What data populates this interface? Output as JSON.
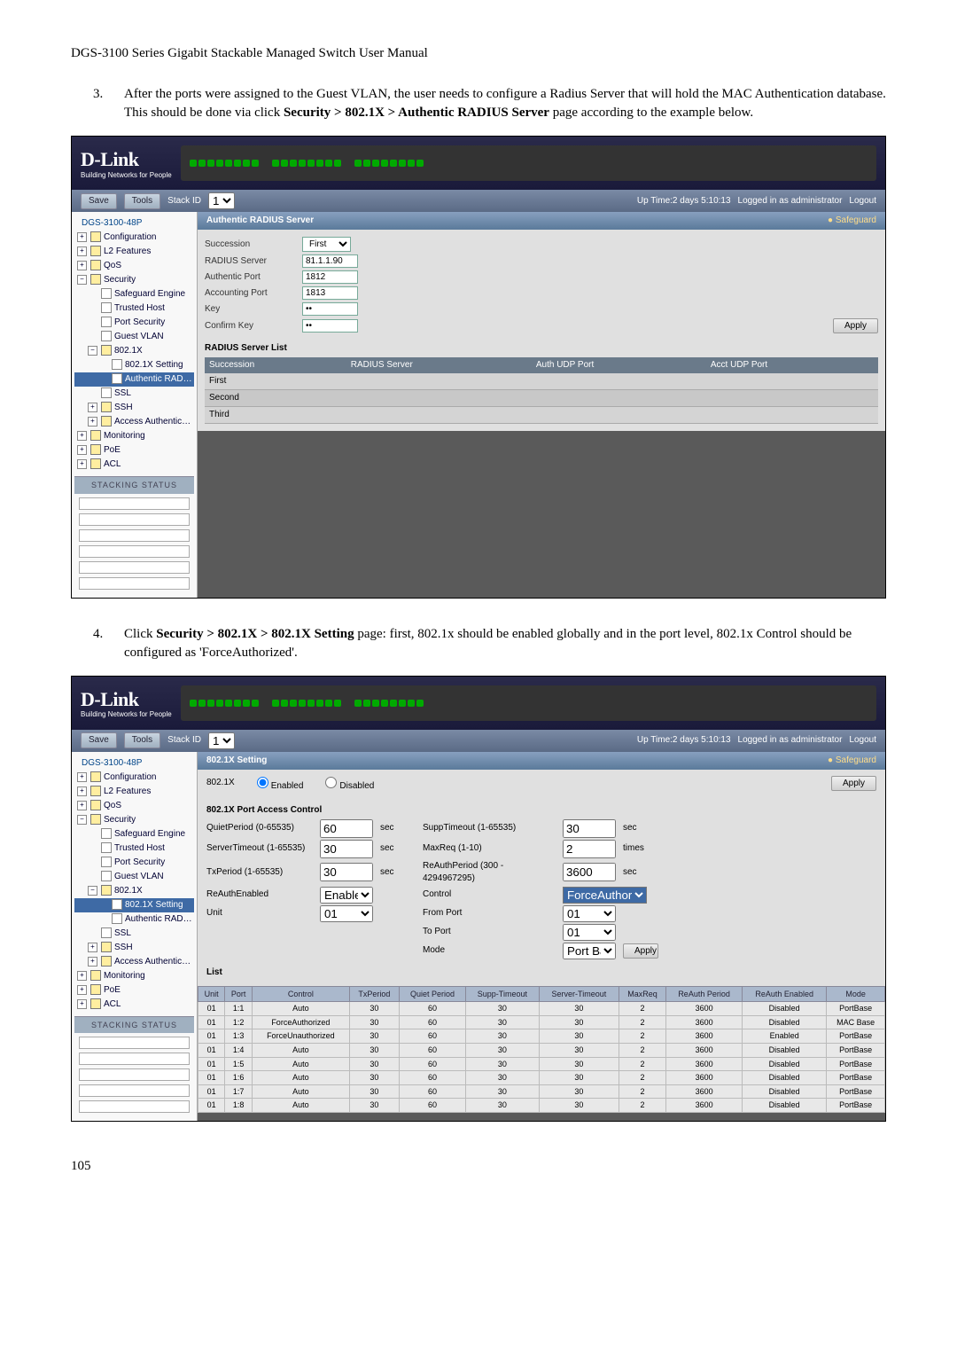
{
  "header": {
    "title": "DGS-3100 Series Gigabit Stackable Managed Switch User Manual"
  },
  "step3": {
    "num": "3.",
    "text_before": "After the ports were assigned to the Guest VLAN, the user needs to configure a Radius Server that will hold the MAC Authentication database. This should be done via click ",
    "path": "Security > 802.1X > Authentic RADIUS Server",
    "text_after": " page according to the example below."
  },
  "toolbar": {
    "save": "Save",
    "tools": "Tools",
    "stack": "Stack ID",
    "stack_id": "1",
    "uptime": "Up Time:2 days 5:10:13",
    "login": "Logged in as administrator",
    "logout": "Logout"
  },
  "tree": {
    "root": "DGS-3100-48P",
    "items": [
      "Configuration",
      "L2 Features",
      "QoS",
      "Security"
    ],
    "sec": [
      "Safeguard Engine",
      "Trusted Host",
      "Port Security",
      "Guest VLAN",
      "802.1X"
    ],
    "x8021": [
      "802.1X Setting",
      "Authentic RADIUS Serv"
    ],
    "sec2": [
      "SSL",
      "SSH",
      "Access Authentication Con"
    ],
    "items2": [
      "Monitoring",
      "PoE",
      "ACL"
    ],
    "stacking": "STACKING STATUS"
  },
  "radius_panel": {
    "title": "Authentic RADIUS Server",
    "safeguard": "Safeguard",
    "fields": {
      "succession_label": "Succession",
      "succession_val": "First",
      "server_label": "RADIUS Server",
      "server_val": "81.1.1.90",
      "auth_label": "Authentic Port",
      "auth_val": "1812",
      "acct_label": "Accounting Port",
      "acct_val": "1813",
      "key_label": "Key",
      "key_val": "••",
      "ckey_label": "Confirm Key",
      "ckey_val": "••",
      "apply": "Apply"
    },
    "list": {
      "title": "RADIUS Server List",
      "cols": [
        "Succession",
        "RADIUS Server",
        "Auth UDP Port",
        "Acct UDP Port"
      ],
      "rows": [
        "First",
        "Second",
        "Third"
      ]
    }
  },
  "step4": {
    "num": "4.",
    "text_before": "Click ",
    "path": "Security > 802.1X > 802.1X Setting",
    "text_after": " page: first, 802.1x should be enabled globally and in the port level, 802.1x Control should be configured as 'ForceAuthorized'."
  },
  "x8021_panel": {
    "title": "802.1X Setting",
    "safeguard": "Safeguard",
    "main_label": "802.1X",
    "enabled": "Enabled",
    "disabled": "Disabled",
    "apply": "Apply",
    "pac_title": "802.1X Port Access Control",
    "fields": {
      "qp_label": "QuietPeriod (0-65535)",
      "qp_val": "60",
      "qp_unit": "sec",
      "st_label": "SuppTimeout (1-65535)",
      "st_val": "30",
      "st_unit": "sec",
      "svr_label": "ServerTimeout (1-65535)",
      "svr_val": "30",
      "svr_unit": "sec",
      "mr_label": "MaxReq (1-10)",
      "mr_val": "2",
      "mr_unit": "times",
      "tx_label": "TxPeriod (1-65535)",
      "tx_val": "30",
      "tx_unit": "sec",
      "rap_label": "ReAuthPeriod (300 - 4294967295)",
      "rap_val": "3600",
      "rap_unit": "sec",
      "rae_label": "ReAuthEnabled",
      "rae_val": "Enabled",
      "ctrl_label": "Control",
      "ctrl_val": "ForceAuthorized",
      "unit_label": "Unit",
      "unit_val": "01",
      "fp_label": "From Port",
      "fp_val": "01",
      "tp_label": "To Port",
      "tp_val": "01",
      "mode_label": "Mode",
      "mode_val": "Port Base"
    },
    "list_title": "List",
    "cols": [
      "Unit",
      "Port",
      "Control",
      "TxPeriod",
      "Quiet Period",
      "Supp-Timeout",
      "Server-Timeout",
      "MaxReq",
      "ReAuth Period",
      "ReAuth Enabled",
      "Mode"
    ],
    "rows": [
      [
        "01",
        "1:1",
        "Auto",
        "30",
        "60",
        "30",
        "30",
        "2",
        "3600",
        "Disabled",
        "PortBase"
      ],
      [
        "01",
        "1:2",
        "ForceAuthorized",
        "30",
        "60",
        "30",
        "30",
        "2",
        "3600",
        "Disabled",
        "MAC Base"
      ],
      [
        "01",
        "1:3",
        "ForceUnauthorized",
        "30",
        "60",
        "30",
        "30",
        "2",
        "3600",
        "Enabled",
        "PortBase"
      ],
      [
        "01",
        "1:4",
        "Auto",
        "30",
        "60",
        "30",
        "30",
        "2",
        "3600",
        "Disabled",
        "PortBase"
      ],
      [
        "01",
        "1:5",
        "Auto",
        "30",
        "60",
        "30",
        "30",
        "2",
        "3600",
        "Disabled",
        "PortBase"
      ],
      [
        "01",
        "1:6",
        "Auto",
        "30",
        "60",
        "30",
        "30",
        "2",
        "3600",
        "Disabled",
        "PortBase"
      ],
      [
        "01",
        "1:7",
        "Auto",
        "30",
        "60",
        "30",
        "30",
        "2",
        "3600",
        "Disabled",
        "PortBase"
      ],
      [
        "01",
        "1:8",
        "Auto",
        "30",
        "60",
        "30",
        "30",
        "2",
        "3600",
        "Disabled",
        "PortBase"
      ]
    ]
  },
  "page_num": "105"
}
